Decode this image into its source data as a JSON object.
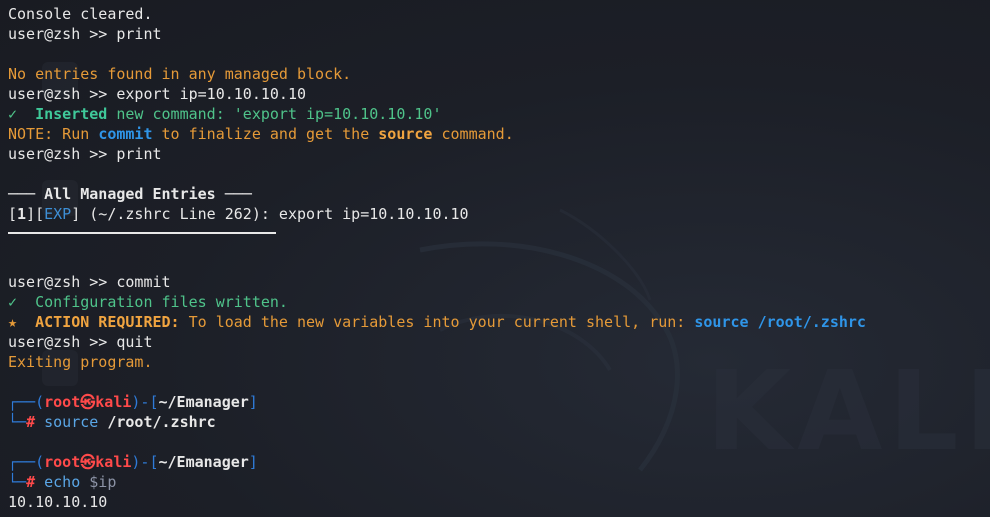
{
  "terminal": {
    "lines": [
      {
        "a": "Console cleared."
      },
      {
        "a": "user@zsh >> print"
      },
      {
        "a": ""
      },
      {
        "a": "No entries found in any managed block."
      },
      {
        "a": "user@zsh >> export ip=10.10.10.10"
      },
      {
        "check": "✓",
        "ins": "Inserted",
        "a": " new command: 'export ip=10.10.10.10'"
      },
      {
        "note": "NOTE: Run ",
        "commit": "commit",
        "mid": " to finalize and get the ",
        "source": "source",
        "end": " command."
      },
      {
        "a": "user@zsh >> print"
      },
      {
        "a": ""
      },
      {
        "dash_l": "─── ",
        "title": "All Managed Entries",
        "dash_r": " ───"
      },
      {
        "b1": "[",
        "n": "1",
        "b2": "][",
        "exp": "EXP",
        "b3": "] (~/.zshrc Line 262): export ip=10.10.10.10"
      },
      {
        "rule": true
      },
      {
        "a": ""
      },
      {
        "a": "user@zsh >> commit"
      },
      {
        "check": "✓",
        "a": "  Configuration files written."
      },
      {
        "star": "★",
        "req": "ACTION REQUIRED:",
        "a": " To load the new variables into your current shell, run: ",
        "cmd": "source /root/.zshrc"
      },
      {
        "a": "user@zsh >> quit"
      },
      {
        "a": "Exiting program."
      }
    ],
    "prompt1": {
      "top_l": "┌──(",
      "user": "root",
      "at": "㉿",
      "host": "kali",
      "mid": ")-[",
      "dir": "~/Emanager",
      "top_r": "]",
      "bot": "└─",
      "hash": "#",
      "cmd": "source",
      "arg": "/root/.zshrc"
    },
    "prompt2": {
      "top_l": "┌──(",
      "user": "root",
      "at": "㉿",
      "host": "kali",
      "mid": ")-[",
      "dir": "~/Emanager",
      "top_r": "]",
      "bot": "└─",
      "hash": "#",
      "cmd": "echo",
      "arg": "$ip"
    },
    "output": "10.10.10.10"
  },
  "wallpaper": {
    "watermark": "KALI"
  }
}
